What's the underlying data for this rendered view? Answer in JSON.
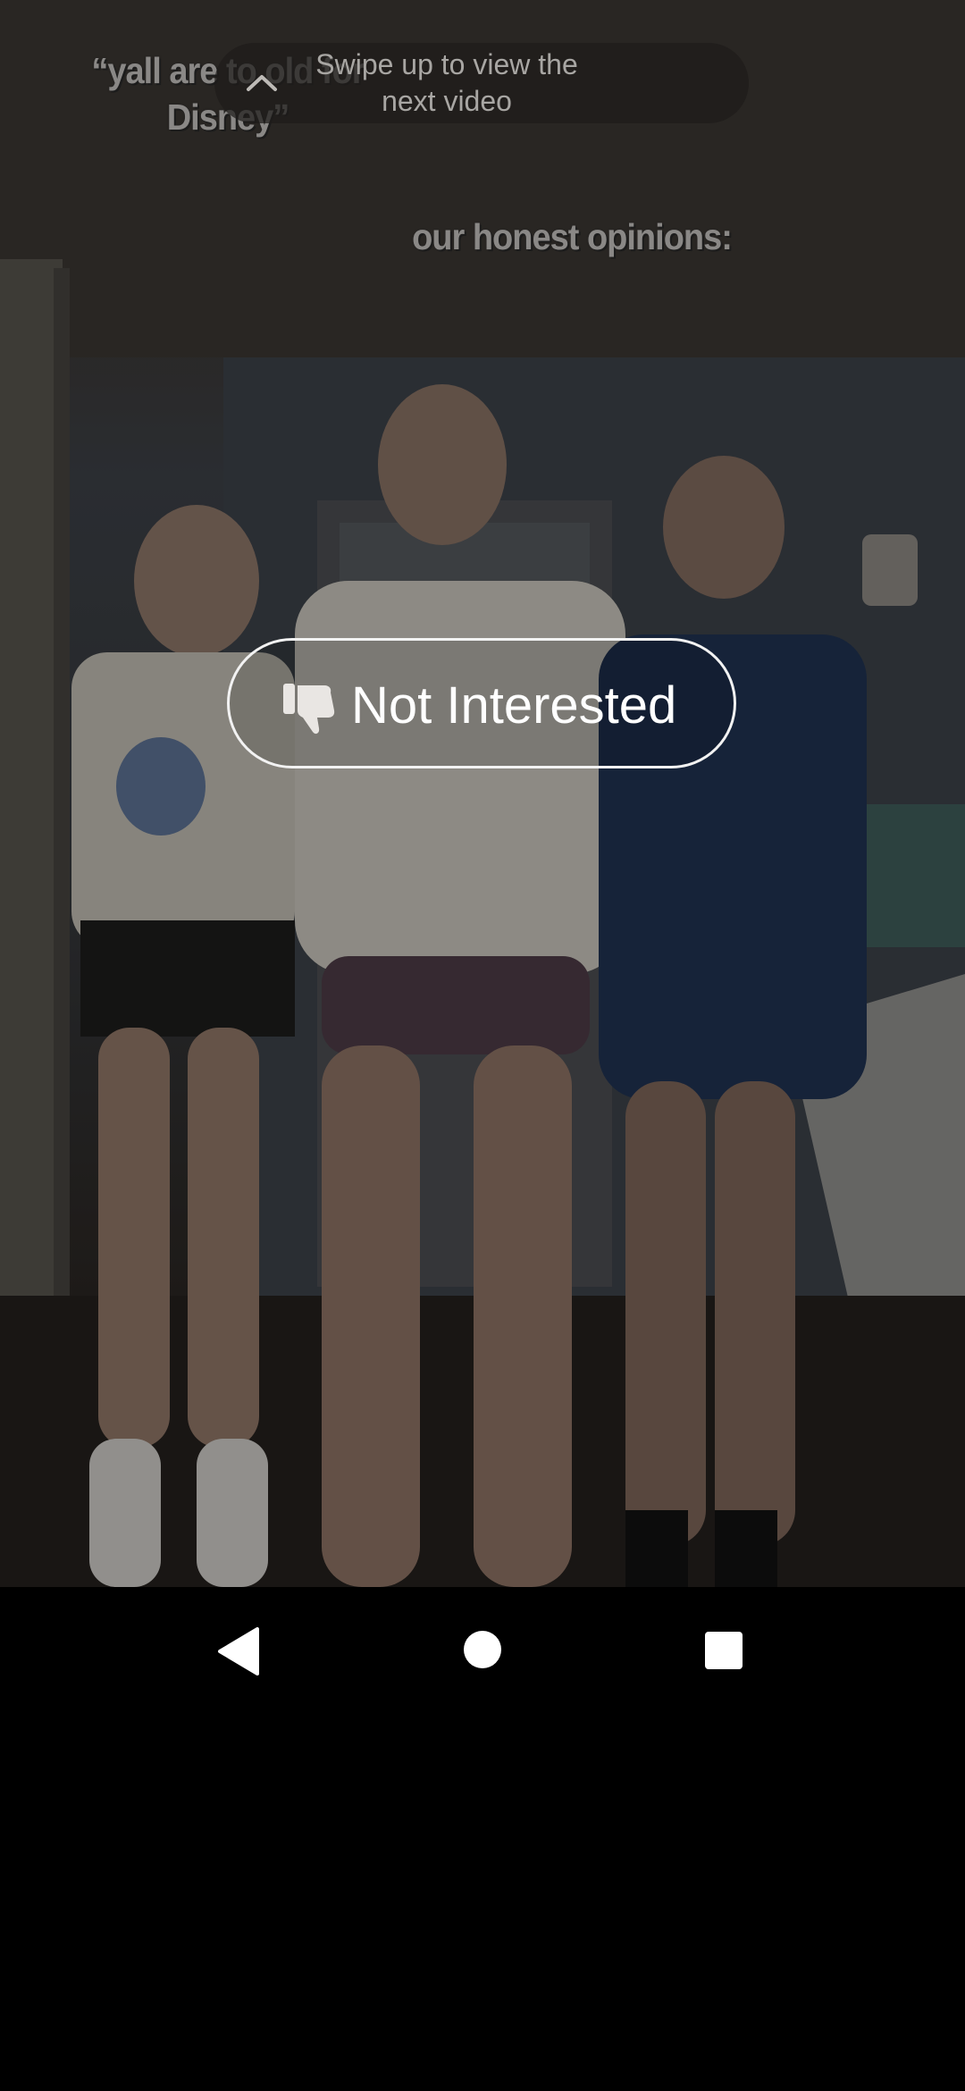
{
  "video": {
    "caption_top": "“yall are to old for Disney”",
    "caption_middle": "our honest opinions:"
  },
  "swipe_hint": {
    "text": "Swipe up to view the next video",
    "icon": "chevron-up-icon"
  },
  "not_interested": {
    "label": "Not Interested",
    "icon": "thumbs-down-icon"
  },
  "nav_bar": {
    "back_icon": "back-triangle-icon",
    "home_icon": "home-circle-icon",
    "recents_icon": "recents-square-icon"
  },
  "colors": {
    "overlay_button_border": "#f2f2f2",
    "nav_background": "#000000",
    "nav_icon": "#ffffff"
  }
}
